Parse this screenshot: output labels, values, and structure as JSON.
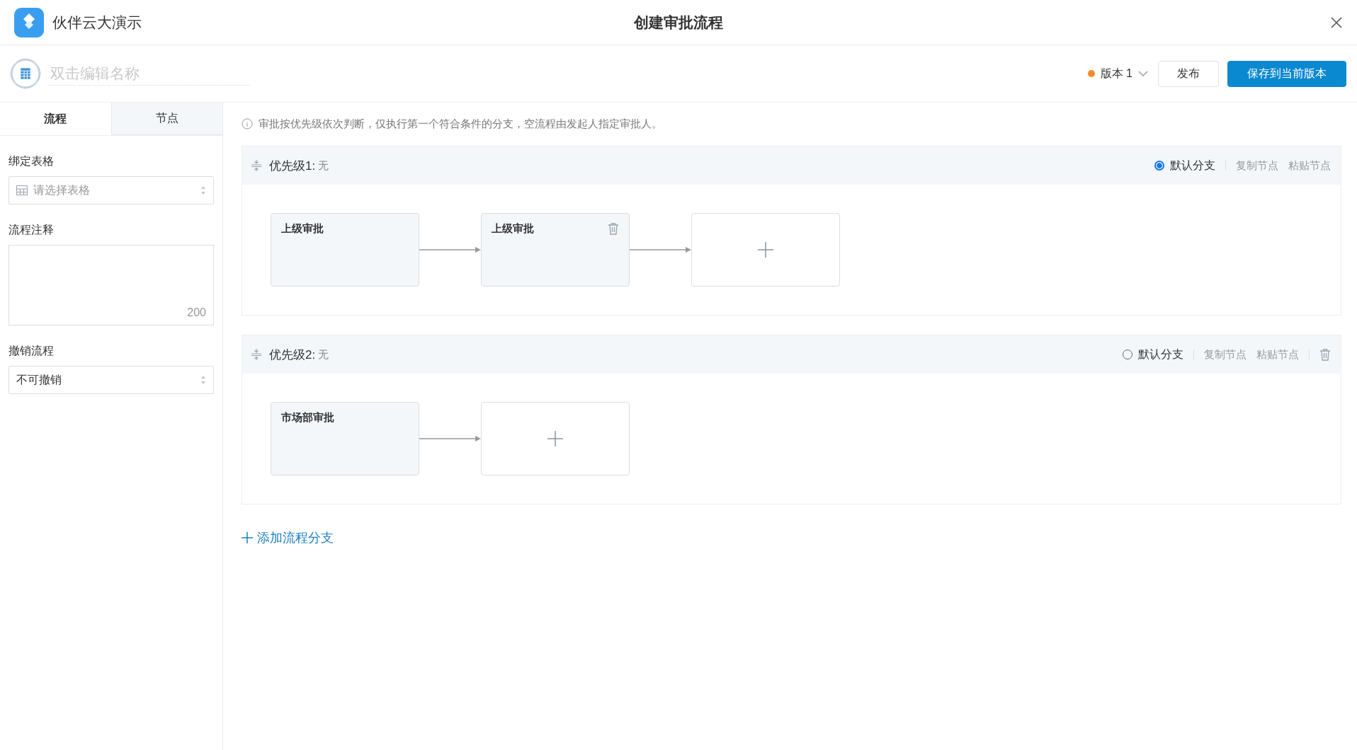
{
  "app": {
    "name": "伙伴云大演示"
  },
  "window": {
    "title": "创建审批流程"
  },
  "toolbar": {
    "name_placeholder": "双击编辑名称",
    "version": "版本 1",
    "buttons": [
      {
        "label": "发布",
        "kind": "secondary"
      },
      {
        "label": "保存到当前版本",
        "kind": "primary"
      }
    ]
  },
  "sidebar": {
    "tabs": [
      {
        "label": "流程",
        "selected": true
      },
      {
        "label": "节点",
        "selected": false
      }
    ],
    "fields": [
      {
        "kind": "select",
        "label": "绑定表格",
        "placeholder": "请选择表格",
        "with_icon": true
      },
      {
        "kind": "textarea",
        "label": "流程注释",
        "counter": "200"
      },
      {
        "kind": "select",
        "label": "撤销流程",
        "value": "不可撤销",
        "with_icon": false
      }
    ]
  },
  "notice": "审批按优先级依次判断，仅执行第一个符合条件的分支，空流程由发起人指定审批人。",
  "branches": [
    {
      "title": "优先级1:",
      "condition": "无",
      "default_label": "默认分支",
      "selected": true,
      "actions": [
        "复制节点",
        "粘贴节点"
      ],
      "deletable": false,
      "nodes": [
        {
          "kind": "approval",
          "title": "上级审批",
          "show_delete": false
        },
        {
          "kind": "approval",
          "title": "上级审批",
          "show_delete": true
        },
        {
          "kind": "add"
        }
      ]
    },
    {
      "title": "优先级2:",
      "condition": "无",
      "default_label": "默认分支",
      "selected": false,
      "actions": [
        "复制节点",
        "粘贴节点"
      ],
      "deletable": true,
      "nodes": [
        {
          "kind": "approval",
          "title": "市场部审批",
          "show_delete": false
        },
        {
          "kind": "add"
        }
      ]
    }
  ],
  "add_branch": "添加流程分支"
}
